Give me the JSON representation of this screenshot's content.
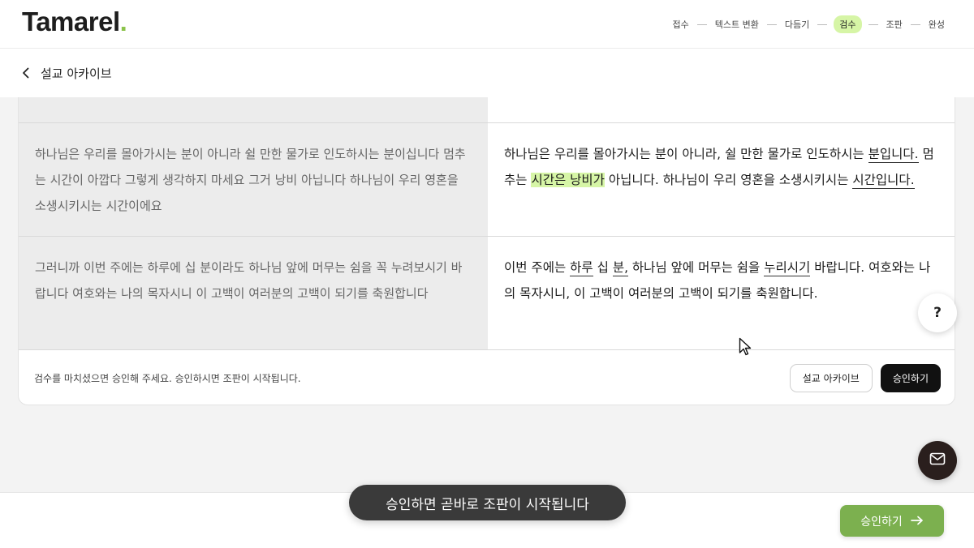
{
  "header": {
    "logo_text": "Tamarel",
    "logo_dot": ".",
    "steps": [
      "접수",
      "텍스트 변환",
      "다듬기",
      "검수",
      "조판",
      "완성"
    ],
    "active_step": "검수"
  },
  "subheader": {
    "back_label": "설교 아카이브"
  },
  "rows": [
    {
      "original": "하나님은 우리를 몰아가시는 분이 아니라 쉴 만한 물가로 인도하시는 분이십니다 멈추는 시간이 아깝다 그렇게 생각하지 마세요 그거 낭비 아닙니다 하나님이 우리 영혼을 소생시키시는 시간이에요",
      "edited_parts": [
        {
          "text": "하나님은 우리를 몰아가시는 분이 아니라, 쉴 만한 물가로 인도하시는 ",
          "style": ""
        },
        {
          "text": "분입니다.",
          "style": "u"
        },
        {
          "text": " 멈추는 ",
          "style": ""
        },
        {
          "text": "시간은 낭비가",
          "style": "hl"
        },
        {
          "text": " 아닙니다. 하나님이 우리 영혼을 소생시키시는 ",
          "style": ""
        },
        {
          "text": "시간입니다.",
          "style": "u"
        }
      ]
    },
    {
      "original": "그러니까 이번 주에는 하루에 십 분이라도 하나님 앞에 머무는 쉼을 꼭 누려보시기 바랍니다 여호와는 나의 목자시니 이 고백이 여러분의 고백이 되기를 축원합니다",
      "edited_parts": [
        {
          "text": "이번 주에는 ",
          "style": ""
        },
        {
          "text": "하루",
          "style": "u"
        },
        {
          "text": " 십 ",
          "style": ""
        },
        {
          "text": "분,",
          "style": "u"
        },
        {
          "text": " 하나님 앞에 머무는 쉼을 ",
          "style": ""
        },
        {
          "text": "누리시기",
          "style": "u"
        },
        {
          "text": " 바랍니다. 여호와는 나의 목자시니, 이 고백이 여러분의 고백이 되기를 축원합니다.",
          "style": ""
        }
      ]
    }
  ],
  "footer": {
    "notice": "검수를 마치셨으면 승인해 주세요. 승인하시면 조판이 시작됩니다.",
    "archive_button": "설교 아카이브",
    "approve_button": "승인하기"
  },
  "floating": {
    "help_label": "?",
    "help_icon": "question-icon",
    "mail_icon": "mail-icon"
  },
  "toast": {
    "message": "승인하면 곧바로 조판이 시작됩니다"
  },
  "bottom_bar": {
    "approve_label": "승인하기",
    "arrow_icon": "arrow-right-icon"
  },
  "colors": {
    "accent_green": "#7cb04f",
    "highlight": "#d6f5a6",
    "logo_dot": "#8bc34a"
  }
}
